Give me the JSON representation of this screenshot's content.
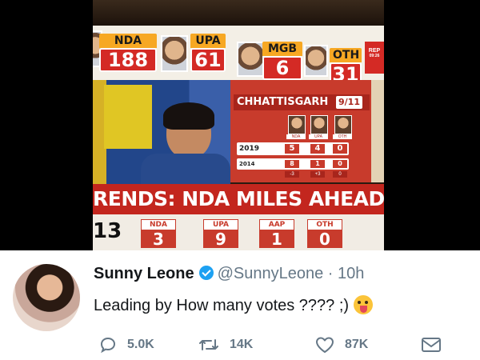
{
  "tv": {
    "scoreboard": [
      {
        "party": "NDA",
        "seats": "188"
      },
      {
        "party": "UPA",
        "seats": "61"
      },
      {
        "party": "MGB",
        "seats": "6"
      },
      {
        "party": "OTH",
        "seats": "31"
      }
    ],
    "corner_tag": "REP",
    "corner_time": "09:26",
    "state_name": "CHHATTISGARH",
    "state_count": "9/11",
    "candidate_tags": [
      "NDA",
      "UPA",
      "OTH"
    ],
    "rows": [
      {
        "year": "2019",
        "cells": [
          "5",
          "4",
          "0"
        ]
      },
      {
        "year": "2014",
        "cells": [
          "8",
          "1",
          "0"
        ]
      }
    ],
    "swing": [
      "-3",
      "+3",
      "0"
    ],
    "headline": "RENDS: NDA MILES AHEAD",
    "bottom_number": "13",
    "bottom_tiles": [
      {
        "party": "NDA",
        "seats": "3"
      },
      {
        "party": "UPA",
        "seats": "9"
      },
      {
        "party": "AAP",
        "seats": "1"
      },
      {
        "party": "OTH",
        "seats": "0"
      }
    ]
  },
  "tweet": {
    "name": "Sunny Leone",
    "handle": "@SunnyLeone",
    "separator": "·",
    "time": "10h",
    "text": "Leading by How many votes ???? ;)",
    "emoji": "winking-tongue-emoji",
    "replies": "5.0K",
    "retweets": "14K",
    "likes": "87K"
  },
  "colors": {
    "accent": "#1da1f2",
    "channel_red": "#c3261e",
    "tile_orange": "#f7a823"
  }
}
